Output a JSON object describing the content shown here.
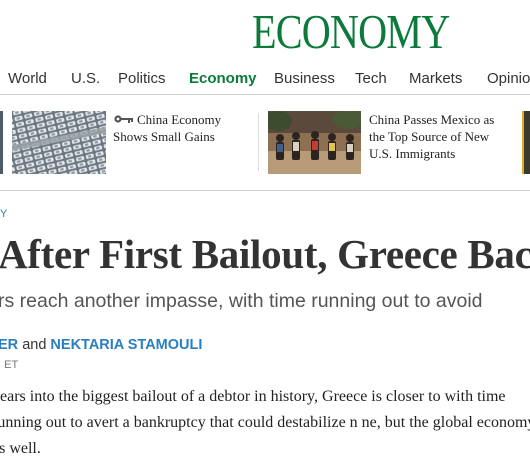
{
  "masthead": {
    "section_title": "ECONOMY"
  },
  "nav": {
    "items": [
      "World",
      "U.S.",
      "Politics",
      "Economy",
      "Business",
      "Tech",
      "Markets",
      "Opinio"
    ],
    "active": "Economy"
  },
  "promos": [
    {
      "headline": "China Economy Shows Small Gains",
      "icon": "key-icon"
    },
    {
      "headline": "China Passes Mexico as the Top Source of New U.S. Immigrants"
    }
  ],
  "article": {
    "kicker": "Y",
    "headline": "After First Bailout, Greece Bac",
    "summary": "rs reach another impasse, with time running out to avoid",
    "authors": [
      "ER",
      "NEKTARIA STAMOULI"
    ],
    "byline_joiner": "and",
    "timestamp": ". ET",
    "body": "years into the biggest bailout of a debtor in history, Greece is closer to with time running out to avert a bankruptcy that could destabilize n ne, but the global economy as well."
  },
  "colors": {
    "brand_green": "#0b7a3a",
    "link_blue": "#2a7fbf"
  }
}
